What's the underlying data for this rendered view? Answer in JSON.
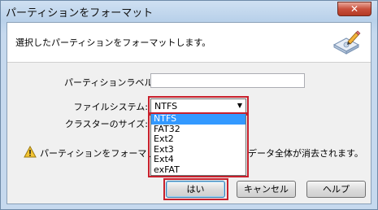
{
  "window": {
    "title": "パーティションをフォーマット",
    "close_glyph": "✕"
  },
  "header": {
    "text": "選択したパーティションをフォーマットします。",
    "icon": "format-disk-icon"
  },
  "form": {
    "partition_label": {
      "label": "パーティションラベル:",
      "value": ""
    },
    "file_system": {
      "label": "ファイルシステム:",
      "selected": "NTFS",
      "options": [
        "NTFS",
        "FAT32",
        "Ext2",
        "Ext3",
        "Ext4",
        "exFAT"
      ]
    },
    "cluster_size": {
      "label": "クラスターのサイズ:"
    }
  },
  "warning": {
    "icon": "warning-icon",
    "text_visible_left": "パーティションをフォーマットす",
    "text_visible_right": "データ全体が消去されます。"
  },
  "buttons": {
    "ok": "はい",
    "cancel": "キャンセル",
    "help": "ヘルプ"
  },
  "colors": {
    "highlight": "#c8202c",
    "selection": "#3399ff"
  }
}
